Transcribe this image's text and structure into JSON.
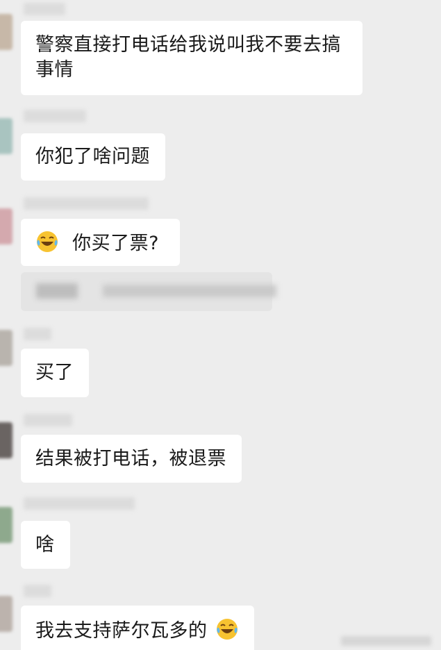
{
  "messages": [
    {
      "text": "警察直接打电话给我说叫我不要去搞事情"
    },
    {
      "text": "你犯了啥问题"
    },
    {
      "emoji": "laugh-tears-emoji",
      "text": "你买了票?"
    },
    {
      "text": "买了"
    },
    {
      "text": "结果被打电话，被退票"
    },
    {
      "text": "啥"
    },
    {
      "text": "我去支持萨尔瓦多的",
      "emoji": "laugh-tears-emoji"
    }
  ],
  "colors": {
    "background": "#ededed",
    "bubble": "#ffffff",
    "text": "#1a1a1a",
    "emoji_face": "#f7c331"
  }
}
